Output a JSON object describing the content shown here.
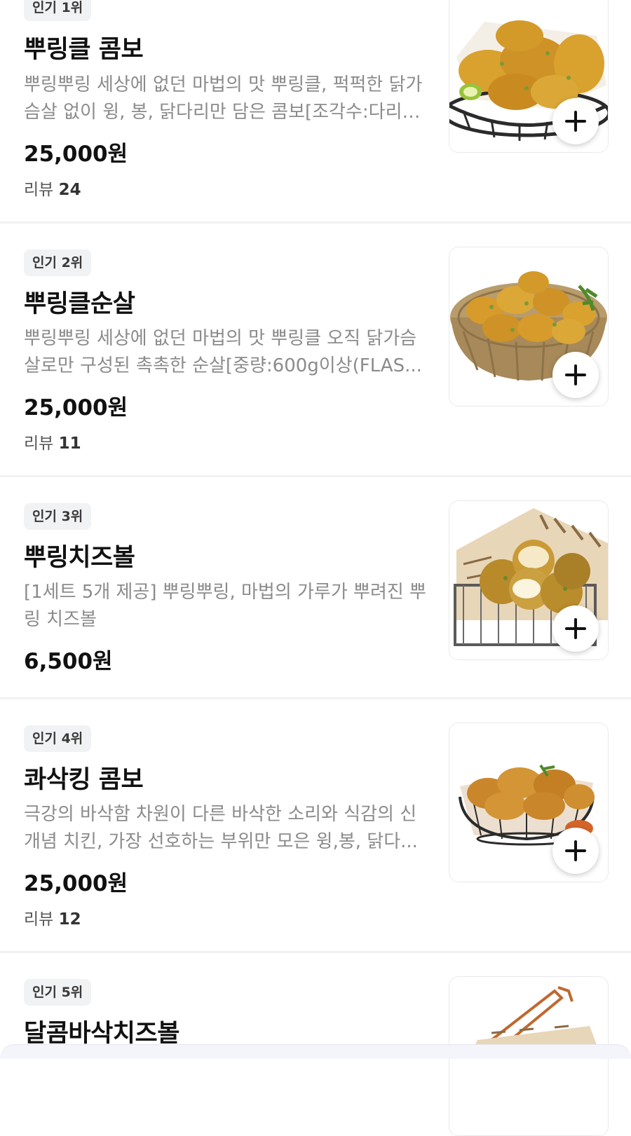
{
  "menu_items": [
    {
      "rank_badge": "인기 1위",
      "name": "뿌링클 콤보",
      "description": "뿌링뿌링 세상에 없던 마법의 맛 뿌링클, 퍽퍽한 닭가슴살 없이 윙, 봉, 닭다리만 담은 콤보[조각수:다리…",
      "price": "25,000원",
      "review_label": "리뷰",
      "review_count": "24",
      "image": "fried-chicken-combo-basket"
    },
    {
      "rank_badge": "인기 2위",
      "name": "뿌링클순살",
      "description": "뿌링뿌링 세상에 없던 마법의 맛 뿌링클 오직 닭가슴살로만 구성된 촉촉한 순살[중량:600g이상(FLAS...",
      "price": "25,000원",
      "review_label": "리뷰",
      "review_count": "11",
      "image": "boneless-chicken-basket"
    },
    {
      "rank_badge": "인기 3위",
      "name": "뿌링치즈볼",
      "description": "[1세트 5개 제공] 뿌링뿌링, 마법의 가루가 뿌려진 뿌링 치즈볼",
      "price": "6,500원",
      "image": "cheese-ball-basket"
    },
    {
      "rank_badge": "인기 4위",
      "name": "콰삭킹 콤보",
      "description": "극강의 바삭함 차원이 다른 바삭한 소리와 식감의 신개념 치킨, 가장 선호하는 부위만 모은 윙,봉, 닭다...",
      "price": "25,000원",
      "review_label": "리뷰",
      "review_count": "12",
      "image": "crispy-chicken-basket"
    },
    {
      "rank_badge": "인기 5위",
      "name": "달콤바삭치즈볼",
      "image": "sweet-cheese-ball-basket"
    }
  ],
  "colors": {
    "badge_bg": "#f1f2f4",
    "description_text": "#8b8b8b",
    "divider": "#f2f2f4",
    "fried_golden": "#d9a12e",
    "basket_dark": "#2b2b2b"
  },
  "icons": {
    "add_button": "plus-icon"
  }
}
